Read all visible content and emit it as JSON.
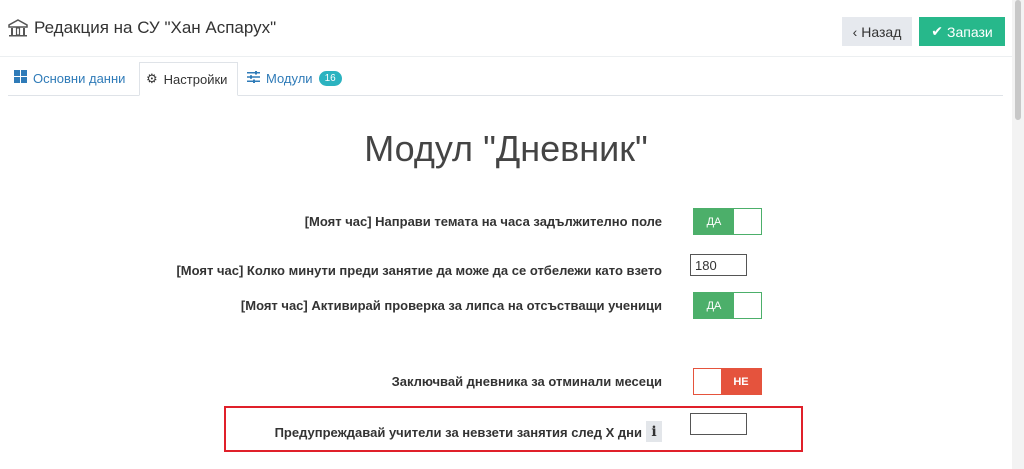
{
  "header": {
    "title": "Редакция на СУ \"Хан Аспарух\"",
    "back_label": "Назад",
    "save_label": "Запази"
  },
  "tabs": [
    {
      "label": "Основни данни",
      "icon": "grid-icon"
    },
    {
      "label": "Настройки",
      "icon": "gears-icon",
      "active": true
    },
    {
      "label": "Модули",
      "icon": "sliders-icon",
      "badge": "16"
    }
  ],
  "module": {
    "title": "Модул \"Дневник\"",
    "settings": [
      {
        "label": "[Моят час] Направи темата на часа задължително поле",
        "type": "toggle",
        "state": "ДА"
      },
      {
        "label": "[Моят час] Колко минути преди занятие да може да се отбележи като взето",
        "type": "number",
        "value": "180"
      },
      {
        "label": "[Моят час] Активирай проверка за липса на отсъстващи ученици",
        "type": "toggle",
        "state": "ДА"
      },
      {
        "label": "Заключвай дневника за отминали месеци",
        "type": "toggle",
        "state": "НЕ"
      },
      {
        "label": "Предупреждавай учители за невзети занятия след X дни",
        "type": "number",
        "value": ""
      }
    ]
  },
  "colors": {
    "accent_green": "#27b88b",
    "toggle_on": "#4caf6a",
    "toggle_off": "#e5533d",
    "highlight": "#e0202a"
  }
}
